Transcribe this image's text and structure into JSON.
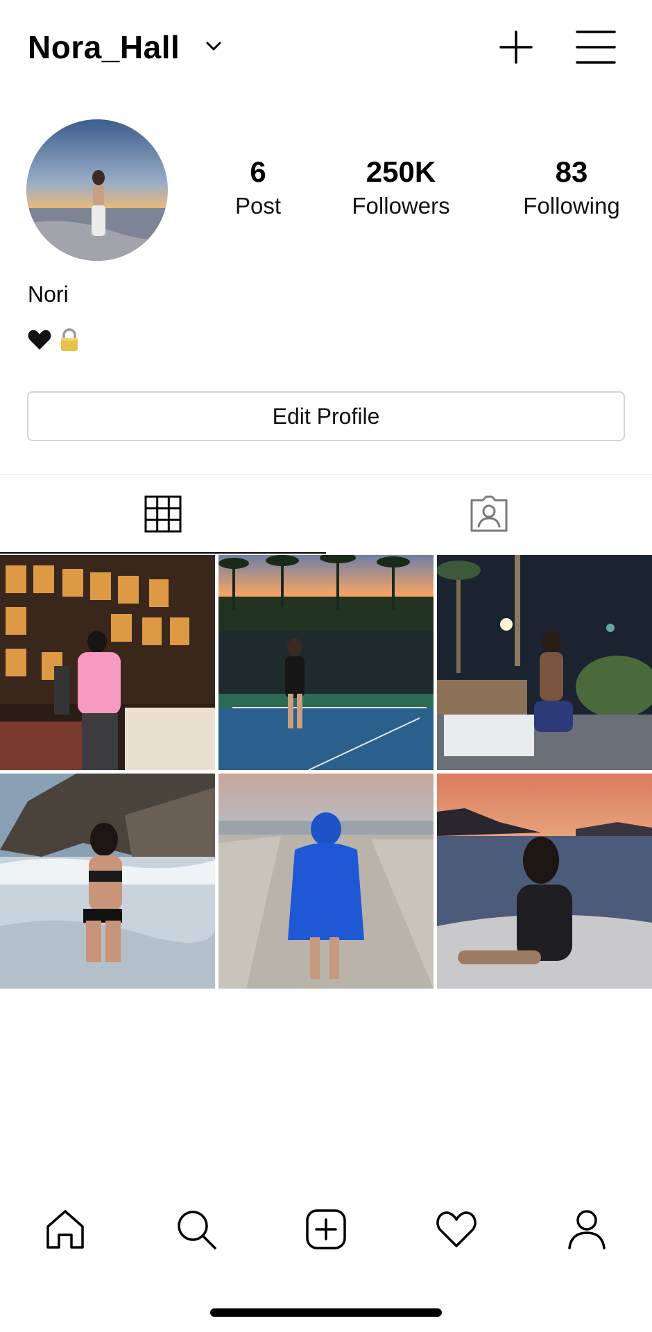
{
  "header": {
    "username": "Nora_Hall"
  },
  "profile": {
    "display_name": "Nori",
    "stats": [
      {
        "value": "6",
        "label": "Post"
      },
      {
        "value": "250K",
        "label": "Followers"
      },
      {
        "value": "83",
        "label": "Following"
      }
    ],
    "bio_emojis": [
      "black-heart-icon",
      "lock-icon"
    ],
    "edit_button_label": "Edit Profile"
  },
  "tabs": {
    "active": "grid",
    "items": [
      "grid-icon",
      "tagged-icon"
    ]
  },
  "posts": [
    {
      "scene": "jersey-store"
    },
    {
      "scene": "tennis-court-sunset"
    },
    {
      "scene": "night-moon-palms"
    },
    {
      "scene": "beach-rocks"
    },
    {
      "scene": "blue-hoodie-beach"
    },
    {
      "scene": "boat-sunset"
    }
  ],
  "bottom_nav": {
    "items": [
      "home-icon",
      "search-icon",
      "create-icon",
      "heart-icon",
      "profile-icon"
    ]
  },
  "colors": {
    "border": "#d6d6d6",
    "text": "#000000"
  }
}
